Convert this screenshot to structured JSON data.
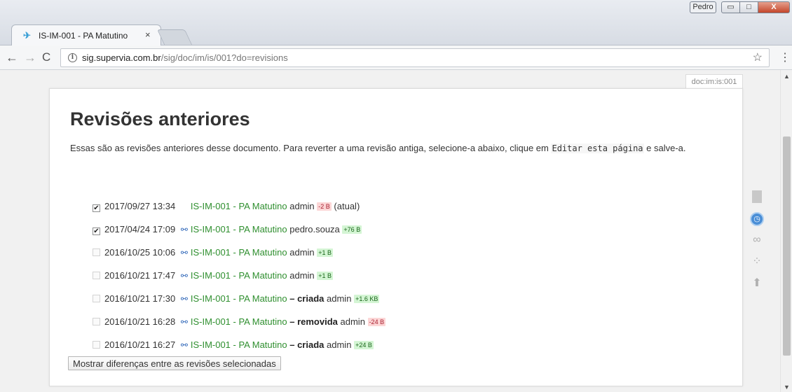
{
  "window": {
    "tab_title": "IS-IM-001 - PA Matutino",
    "tab_close": "×",
    "user_badge": "Pedro",
    "min": "▭",
    "max": "□",
    "close": "X"
  },
  "toolbar": {
    "back": "←",
    "forward": "→",
    "reload": "C",
    "url_host": "sig.supervia.com.br",
    "url_path": "/sig/doc/im/is/001?do=revisions",
    "bookmark": "☆",
    "menu": "⋮"
  },
  "page": {
    "page_id": "doc:im:is:001",
    "heading": "Revisões anteriores",
    "intro_before": "Essas são as revisões anteriores desse documento. Para reverter a uma revisão antiga, selecione-a abaixo, clique em ",
    "intro_code": "Editar esta página",
    "intro_after": " e salve-a.",
    "diff_button": "Mostrar diferenças entre as revisões selecionadas"
  },
  "revisions": [
    {
      "checked": true,
      "enabled": true,
      "date": "2017/09/27 13:34",
      "has_diff": false,
      "page": "IS-IM-001 - PA Matutino",
      "summary": "",
      "user": "admin",
      "size": "-2 B",
      "size_sign": "neg",
      "current": "(atual)"
    },
    {
      "checked": true,
      "enabled": true,
      "date": "2017/04/24 17:09",
      "has_diff": true,
      "page": "IS-IM-001 - PA Matutino",
      "summary": "",
      "user": "pedro.souza",
      "size": "+76 B",
      "size_sign": "pos",
      "current": ""
    },
    {
      "checked": false,
      "enabled": false,
      "date": "2016/10/25 10:06",
      "has_diff": true,
      "page": "IS-IM-001 - PA Matutino",
      "summary": "",
      "user": "admin",
      "size": "+1 B",
      "size_sign": "pos",
      "current": ""
    },
    {
      "checked": false,
      "enabled": false,
      "date": "2016/10/21 17:47",
      "has_diff": true,
      "page": "IS-IM-001 - PA Matutino",
      "summary": "",
      "user": "admin",
      "size": "+1 B",
      "size_sign": "pos",
      "current": ""
    },
    {
      "checked": false,
      "enabled": false,
      "date": "2016/10/21 17:30",
      "has_diff": true,
      "page": "IS-IM-001 - PA Matutino",
      "summary": "– criada",
      "user": "admin",
      "size": "+1.6 KB",
      "size_sign": "pos",
      "current": ""
    },
    {
      "checked": false,
      "enabled": false,
      "date": "2016/10/21 16:28",
      "has_diff": true,
      "page": "IS-IM-001 - PA Matutino",
      "summary": "– removida",
      "user": "admin",
      "size": "-24 B",
      "size_sign": "neg",
      "current": ""
    },
    {
      "checked": false,
      "enabled": false,
      "date": "2016/10/21 16:27",
      "has_diff": true,
      "page": "IS-IM-001 - PA Matutino",
      "summary": "– criada",
      "user": "admin",
      "size": "+24 B",
      "size_sign": "pos",
      "current": ""
    }
  ],
  "icons": {
    "favicon": "favicon-icon",
    "diff": "compare-glasses-icon",
    "page_tools": [
      "show-page-icon",
      "old-revisions-icon",
      "backlinks-icon",
      "recent-changes-icon",
      "back-to-top-icon"
    ]
  },
  "colors": {
    "link_green": "#2f8f2f",
    "size_neg_bg": "#fcd6d6",
    "size_pos_bg": "#d4f5d4",
    "accent_blue": "#4a8ed6"
  }
}
